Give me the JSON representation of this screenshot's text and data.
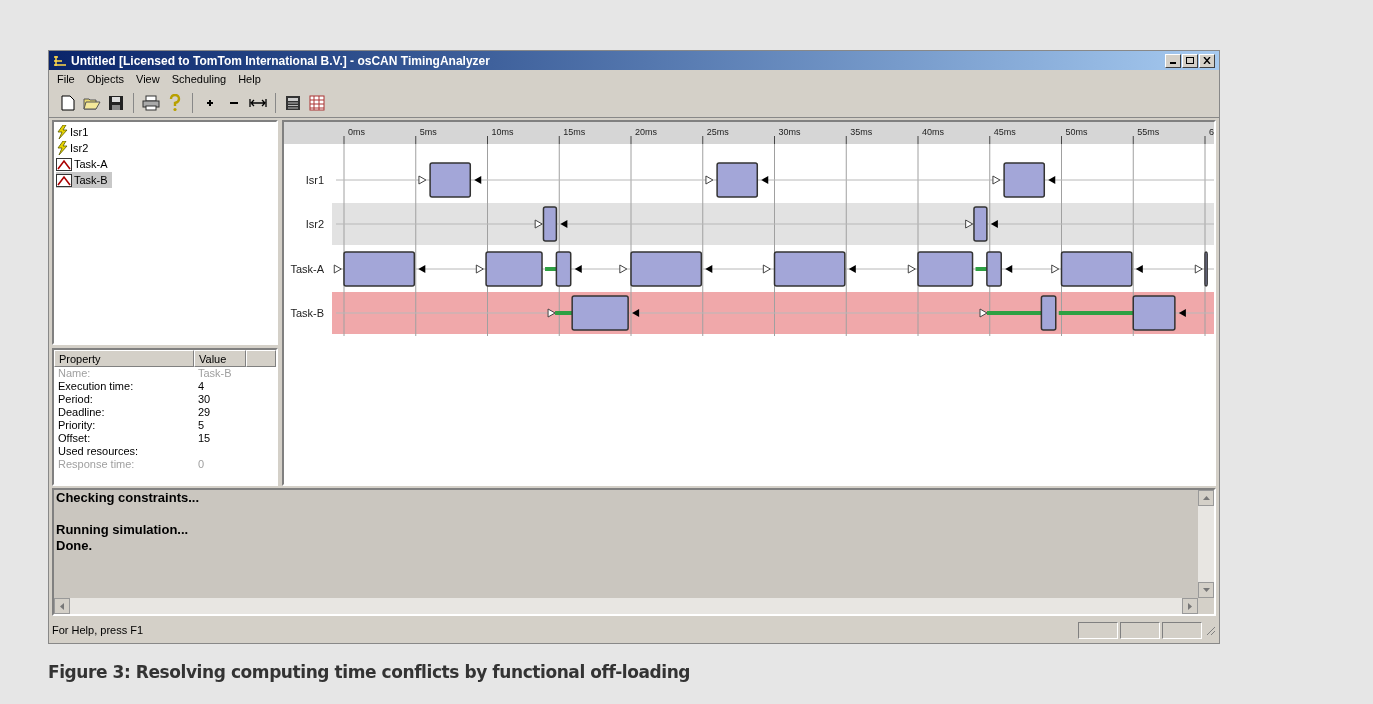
{
  "window": {
    "title": "Untitled [Licensed to TomTom International B.V.] - osCAN TimingAnalyzer"
  },
  "menu": [
    "File",
    "Objects",
    "View",
    "Scheduling",
    "Help"
  ],
  "tree": [
    {
      "label": "Isr1",
      "kind": "isr",
      "selected": false
    },
    {
      "label": "Isr2",
      "kind": "isr",
      "selected": false
    },
    {
      "label": "Task-A",
      "kind": "task",
      "selected": false
    },
    {
      "label": "Task-B",
      "kind": "task",
      "selected": true
    }
  ],
  "properties": {
    "columns": [
      "Property",
      "Value"
    ],
    "rows": [
      {
        "name": "Name:",
        "value": "Task-B",
        "disabled": true
      },
      {
        "name": "Execution time:",
        "value": "4",
        "disabled": false
      },
      {
        "name": "Period:",
        "value": "30",
        "disabled": false
      },
      {
        "name": "Deadline:",
        "value": "29",
        "disabled": false
      },
      {
        "name": "Priority:",
        "value": "5",
        "disabled": false
      },
      {
        "name": "Offset:",
        "value": "15",
        "disabled": false
      },
      {
        "name": "Used resources:",
        "disabled": false
      },
      {
        "name": "Response time:",
        "value": "0",
        "disabled": true
      }
    ]
  },
  "timeline": {
    "ticks": [
      "0ms",
      "5ms",
      "10ms",
      "15ms",
      "20ms",
      "25ms",
      "30ms",
      "35ms",
      "40ms",
      "45ms",
      "50ms",
      "55ms",
      "6"
    ],
    "rows": [
      {
        "label": "Isr1",
        "kind": "plain"
      },
      {
        "label": "Isr2",
        "kind": "shaded"
      },
      {
        "label": "Task-A",
        "kind": "plain"
      },
      {
        "label": "Task-B",
        "kind": "selected"
      }
    ]
  },
  "output": {
    "groups": [
      [
        "Checking constraints..."
      ],
      [
        "Running simulation...",
        "Done."
      ]
    ]
  },
  "status_bar": {
    "text": "For Help, press F1"
  },
  "caption": "Figure 3: Resolving computing time conflicts by functional off-loading"
}
